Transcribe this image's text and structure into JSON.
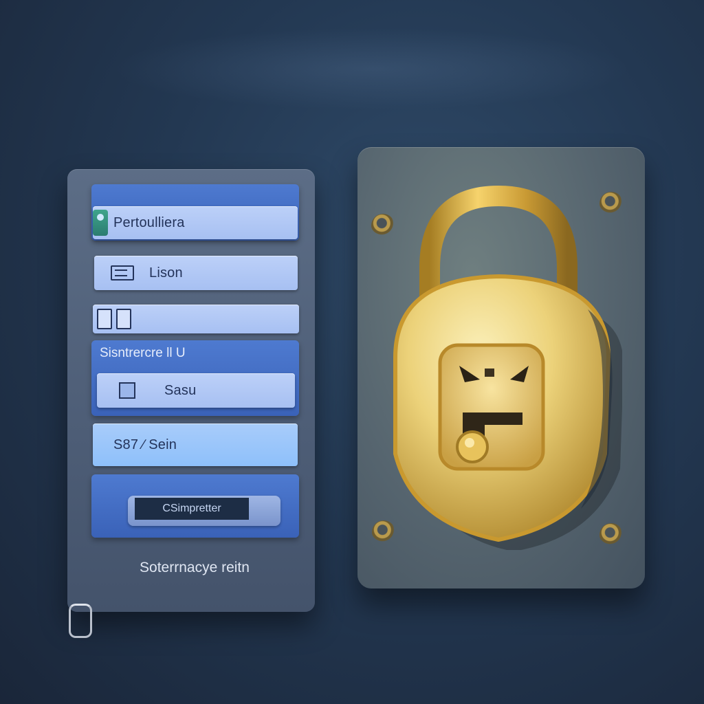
{
  "form": {
    "username_field": "Pertoulliera",
    "login_field": "Lison",
    "section_label": "Sisntrercre ll  U",
    "remember_label": "Sasu",
    "code_field": "S87  ∕  Sein",
    "submit_label": "CSimpretter",
    "footer_text": "Soterrnacye reitn"
  },
  "icons": {
    "user": "user-icon",
    "card": "id-card-icon",
    "small_a": "document-icon",
    "small_b": "document-icon",
    "lock": "padlock-icon",
    "clip": "paperclip-icon"
  },
  "colors": {
    "panel": "#53637c",
    "band": "#3f69bf",
    "field": "#b1c8f5",
    "plate": "#5b6a72",
    "gold": "#e2b64a"
  }
}
